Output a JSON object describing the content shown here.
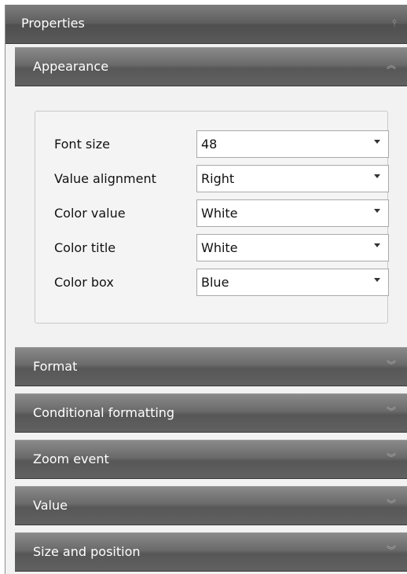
{
  "panel": {
    "title": "Properties",
    "pin_icon": "pin-icon"
  },
  "sections": [
    {
      "label": "Appearance",
      "expanded": true,
      "chevron": "double-chevron-up-icon"
    },
    {
      "label": "Format",
      "expanded": false,
      "chevron": "double-chevron-down-icon"
    },
    {
      "label": "Conditional formatting",
      "expanded": false,
      "chevron": "double-chevron-down-icon"
    },
    {
      "label": "Zoom event",
      "expanded": false,
      "chevron": "double-chevron-down-icon"
    },
    {
      "label": "Value",
      "expanded": false,
      "chevron": "double-chevron-down-icon"
    },
    {
      "label": "Size and position",
      "expanded": false,
      "chevron": "double-chevron-down-icon"
    }
  ],
  "appearance": {
    "fields": [
      {
        "label": "Font size",
        "value": "48"
      },
      {
        "label": "Value alignment",
        "value": "Right"
      },
      {
        "label": "Color value",
        "value": "White"
      },
      {
        "label": "Color title",
        "value": "White"
      },
      {
        "label": "Color box",
        "value": "Blue"
      }
    ]
  },
  "colors": {
    "header_gradient_top": "#8a8a8a",
    "header_gradient_bottom": "#575757",
    "panel_background": "#f2f2f2"
  }
}
